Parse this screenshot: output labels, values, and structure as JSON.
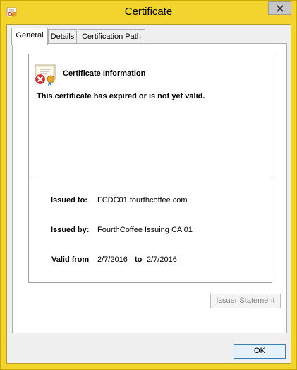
{
  "window": {
    "title": "Certificate",
    "icon": "certificate-app-icon",
    "close_icon": "close-icon"
  },
  "tabs": [
    {
      "label": "General",
      "active": true
    },
    {
      "label": "Details",
      "active": false
    },
    {
      "label": "Certification Path",
      "active": false
    }
  ],
  "general": {
    "icon": "certificate-error-icon",
    "heading": "Certificate Information",
    "warning": "This certificate has expired or is not yet valid.",
    "issued_to_label": "Issued to:",
    "issued_to_value": "FCDC01.fourthcoffee.com",
    "issued_by_label": "Issued by:",
    "issued_by_value": "FourthCoffee Issuing CA 01",
    "valid_from_label": "Valid from",
    "valid_from_value": "2/7/2016",
    "valid_to_label": "to",
    "valid_to_value": "2/7/2016"
  },
  "buttons": {
    "issuer_statement": "Issuer Statement",
    "ok": "OK"
  },
  "colors": {
    "titlebar": "#f3d32e",
    "error_red": "#d22b2b",
    "focus_blue": "#3c7fb1"
  }
}
